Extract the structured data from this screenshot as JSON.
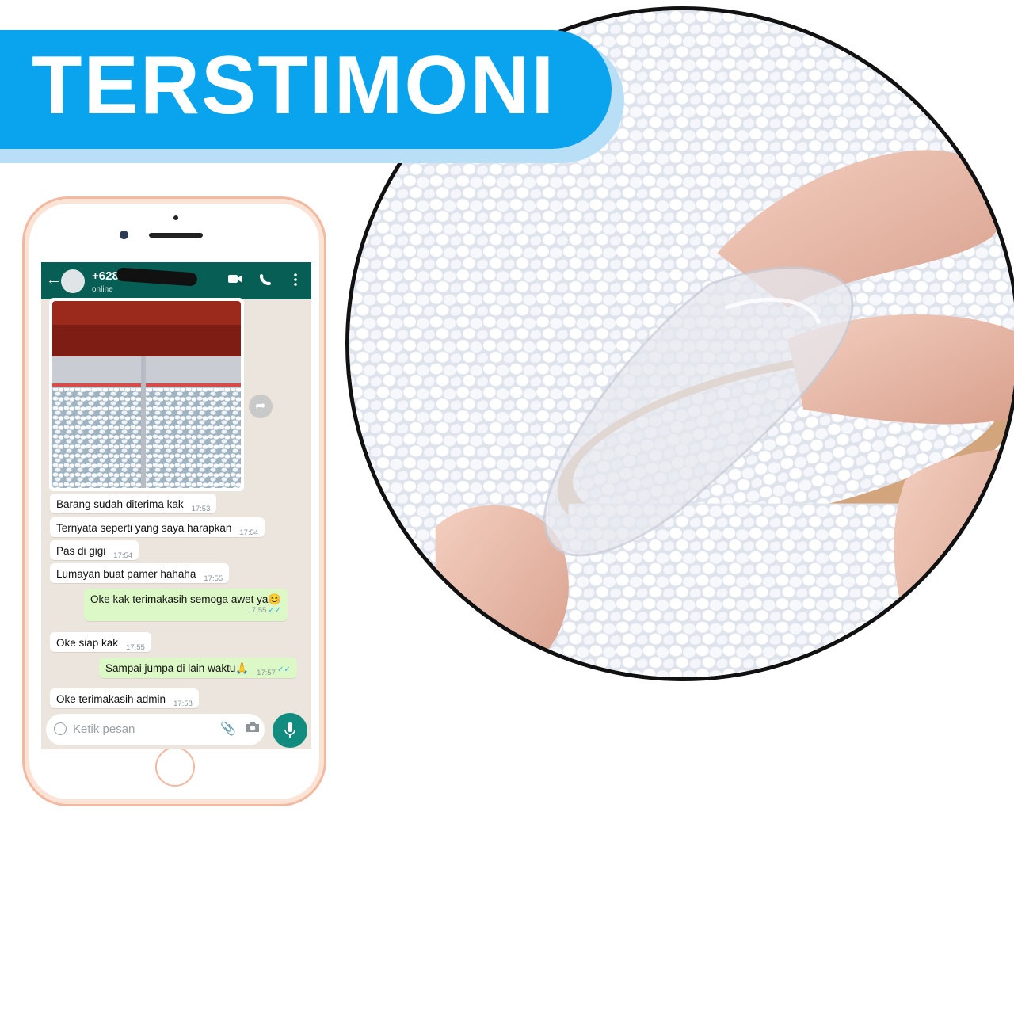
{
  "banner": {
    "title": "TERSTIMONI"
  },
  "header": {
    "contact_number": "+628",
    "status": "online"
  },
  "messages": [
    {
      "text": "Barang sudah diterima kak",
      "time": "17:53",
      "dir": "in"
    },
    {
      "text": "Ternyata seperti yang saya harapkan",
      "time": "17:54",
      "dir": "in"
    },
    {
      "text": "Pas di gigi",
      "time": "17:54",
      "dir": "in"
    },
    {
      "text": "Lumayan buat pamer hahaha",
      "time": "17:55",
      "dir": "in"
    },
    {
      "text": "Oke kak terimakasih semoga awet ya😊",
      "time": "17:55",
      "dir": "out"
    },
    {
      "text": "Oke siap kak",
      "time": "17:55",
      "dir": "in"
    },
    {
      "text": "Sampai jumpa di lain waktu🙏",
      "time": "17:57",
      "dir": "out"
    },
    {
      "text": "Oke terimakasih admin",
      "time": "17:58",
      "dir": "in"
    }
  ],
  "input": {
    "placeholder": "Ketik pesan"
  },
  "icons": {
    "back": "arrow-left-icon",
    "video": "video-call-icon",
    "phone": "phone-icon",
    "menu": "more-vertical-icon",
    "forward": "forward-icon",
    "emoji": "emoji-icon",
    "attach": "paperclip-icon",
    "camera": "camera-icon",
    "mic": "microphone-icon"
  },
  "colors": {
    "banner": "#0aa4ee",
    "whatsapp_header": "#075e54",
    "outgoing_bubble": "#dcf8c6",
    "mic_button": "#128c7e",
    "phone_frame": "#f1b9a0"
  }
}
